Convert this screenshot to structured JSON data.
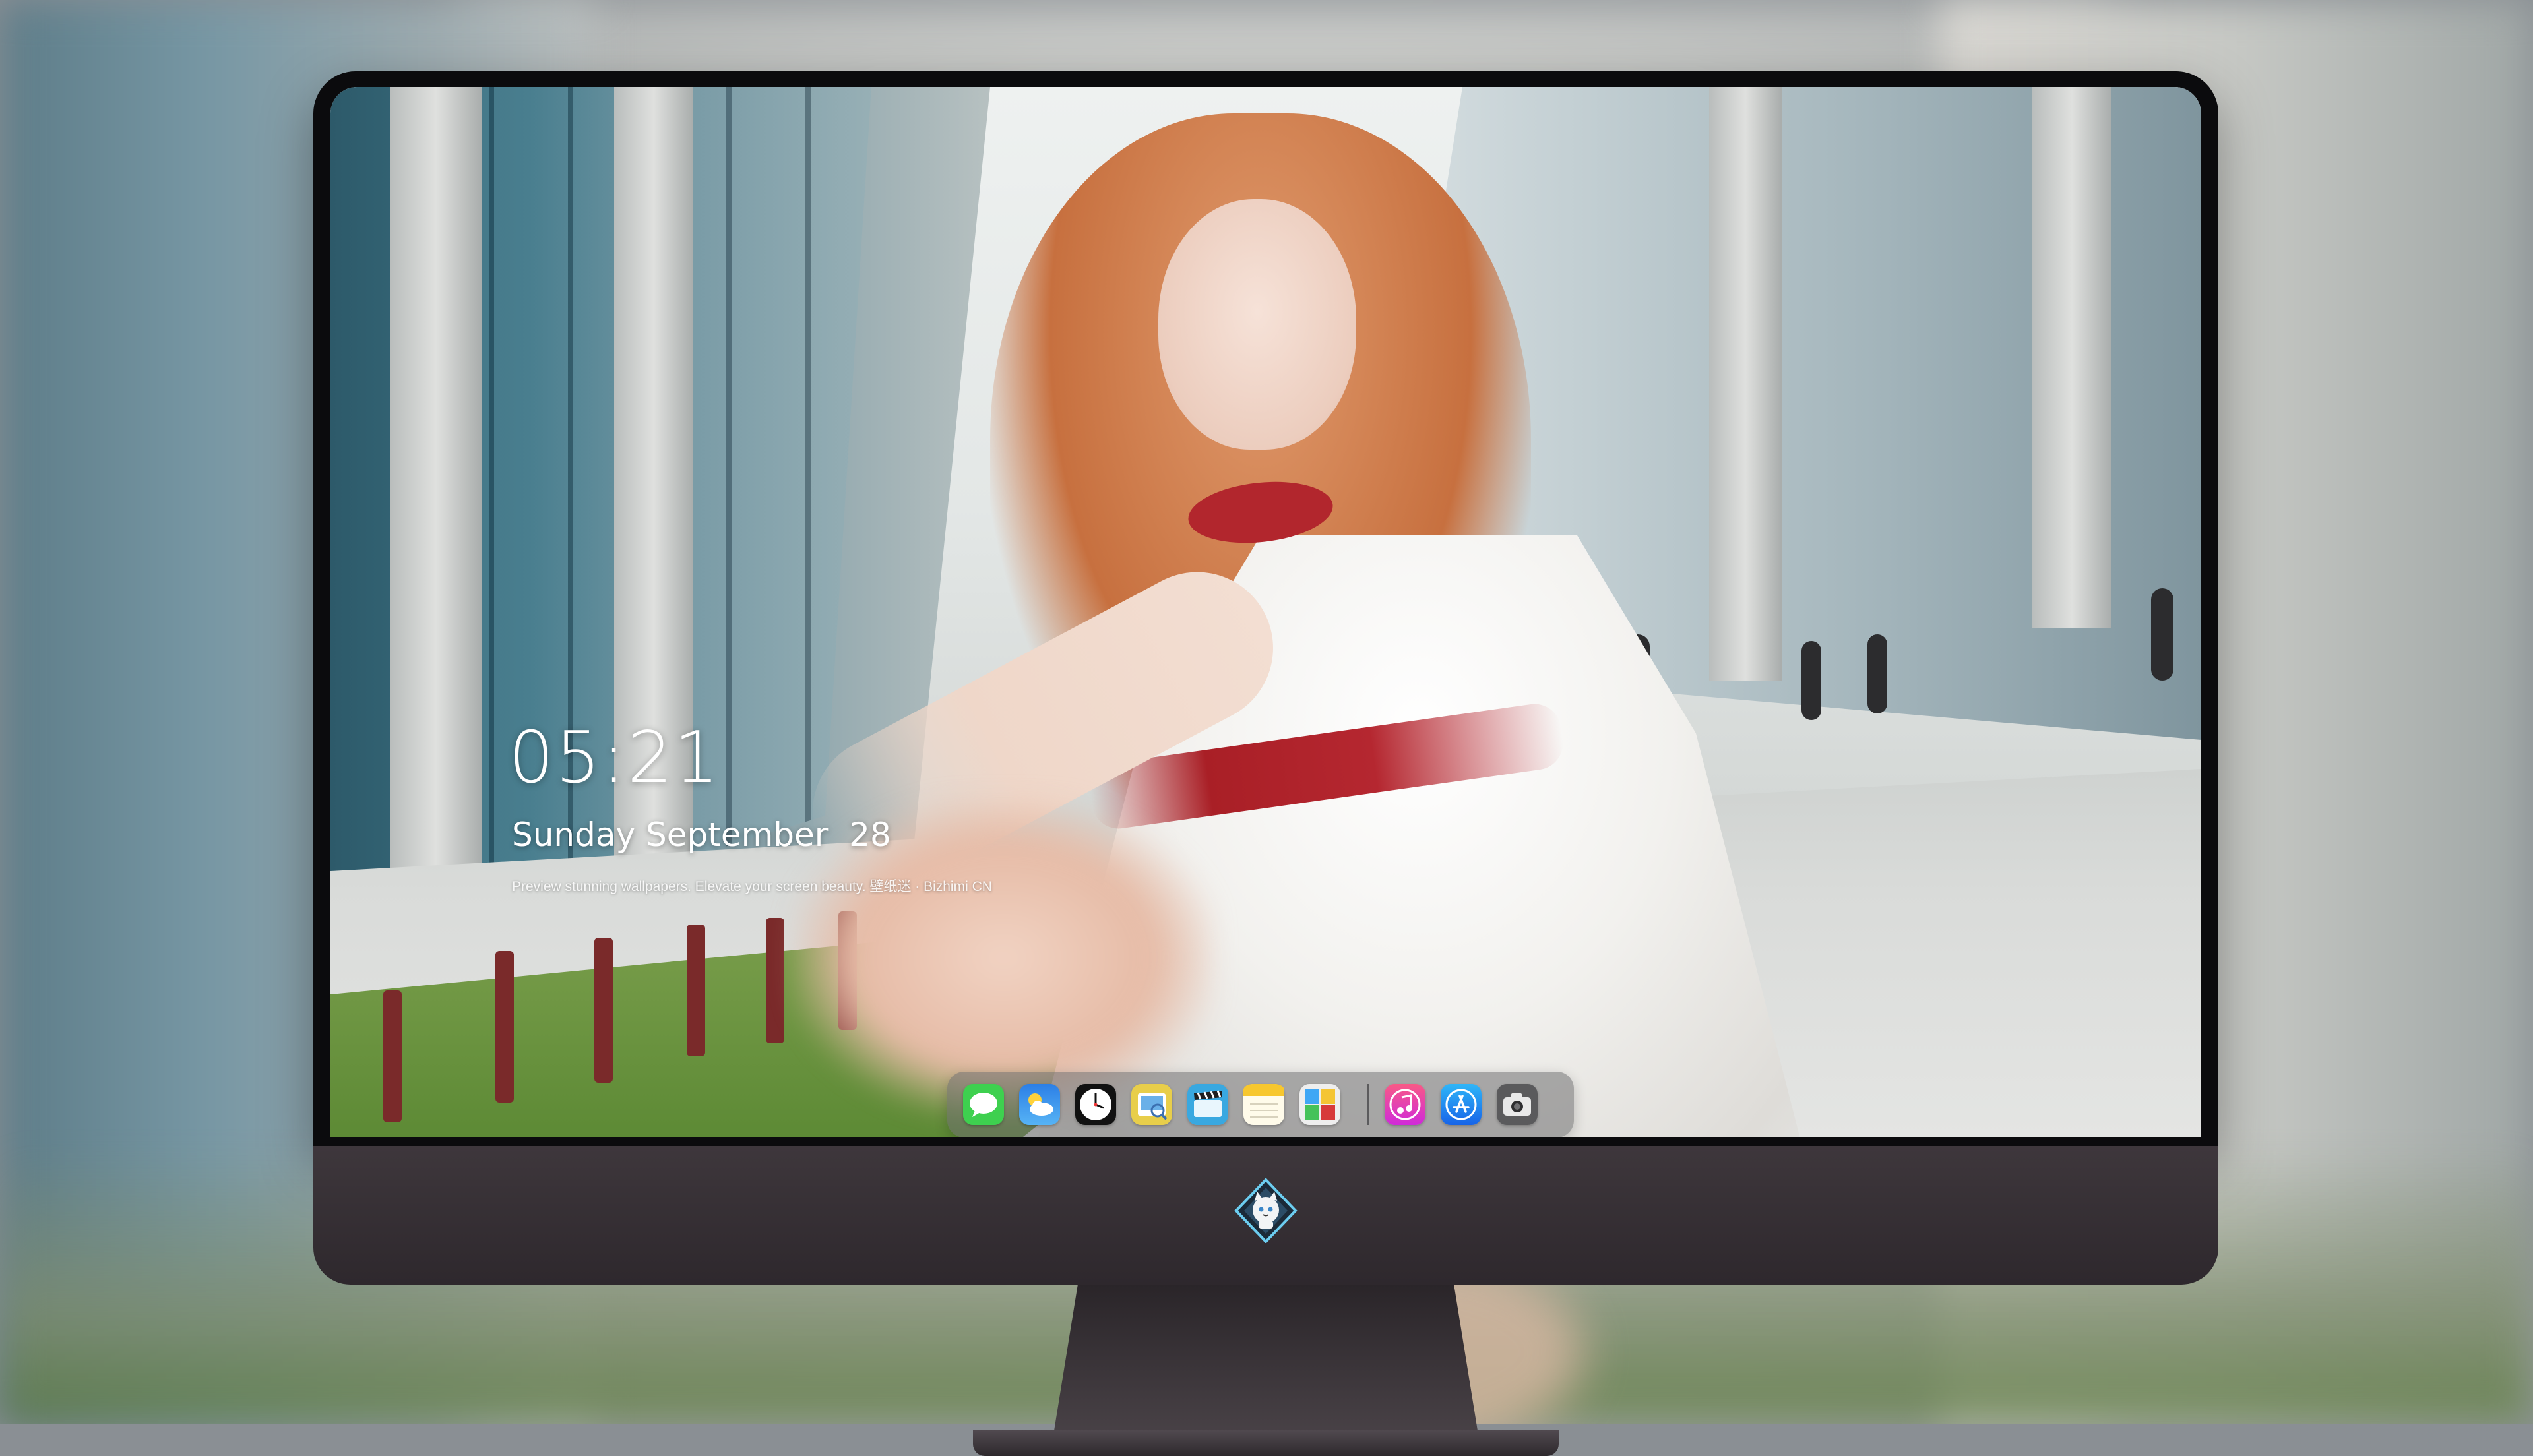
{
  "lock_screen": {
    "time": "05:21",
    "date": "Sunday September  28",
    "tagline": "Preview stunning wallpapers. Elevate your screen beauty. 壁纸迷 · Bizhimi CN"
  },
  "dock": {
    "apps": [
      {
        "name": "Messages",
        "icon": "messages-icon",
        "color": "#3ed04f"
      },
      {
        "name": "Weather",
        "icon": "weather-icon",
        "color": "#2f8ef0"
      },
      {
        "name": "Clock",
        "icon": "clock-icon",
        "color": "#111111"
      },
      {
        "name": "Preview",
        "icon": "preview-icon",
        "color": "#e8ce4a"
      },
      {
        "name": "Clips",
        "icon": "clips-icon",
        "color": "#39a8e0"
      },
      {
        "name": "Notes",
        "icon": "notes-icon",
        "color": "#f7c72e"
      },
      {
        "name": "Photo Booth",
        "icon": "photo-booth-icon",
        "color": "#d73a3a"
      },
      {
        "name": "Music",
        "icon": "music-icon",
        "color": "#f0436a"
      },
      {
        "name": "App Store",
        "icon": "app-store-icon",
        "color": "#1e8ff2"
      },
      {
        "name": "Camera",
        "icon": "camera-icon",
        "color": "#4a4a4c"
      }
    ]
  },
  "monitor": {
    "logo": "cat-mascot-logo-icon",
    "chin_color": "#38323a"
  }
}
